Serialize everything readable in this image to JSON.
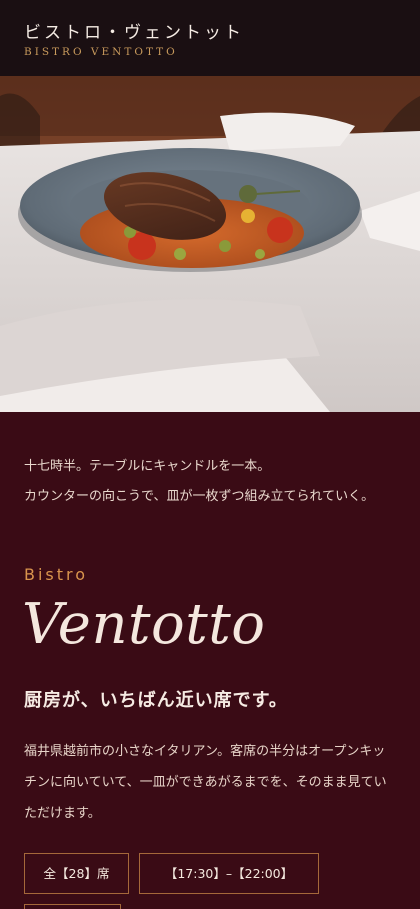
{
  "header": {
    "title_jp": "ビストロ・ヴェントット",
    "title_en": "BISTRO VENTOTTO"
  },
  "hero": {
    "image_description_icon": "plated-dish-photo"
  },
  "intro": {
    "line1": "十七時半。テーブルにキャンドルを一本。",
    "line2": "カウンターの向こうで、皿が一枚ずつ組み立てられていく。"
  },
  "about": {
    "eyebrow": "Bistro",
    "title": "Ventotto",
    "headline": "厨房が、いちばん近い席です。",
    "body": "福井県越前市の小さなイタリアン。客席の半分はオープンキッチンに向いていて、一皿ができあがるまでを、そのまま見ていただけます。"
  },
  "chips": {
    "seats": "全【28】席",
    "hours": "【17:30】–【22:00】"
  },
  "colors": {
    "header_bg": "#1a0f12",
    "content_bg": "#3a0b15",
    "accent": "#d9944d",
    "border": "#a5683a"
  }
}
